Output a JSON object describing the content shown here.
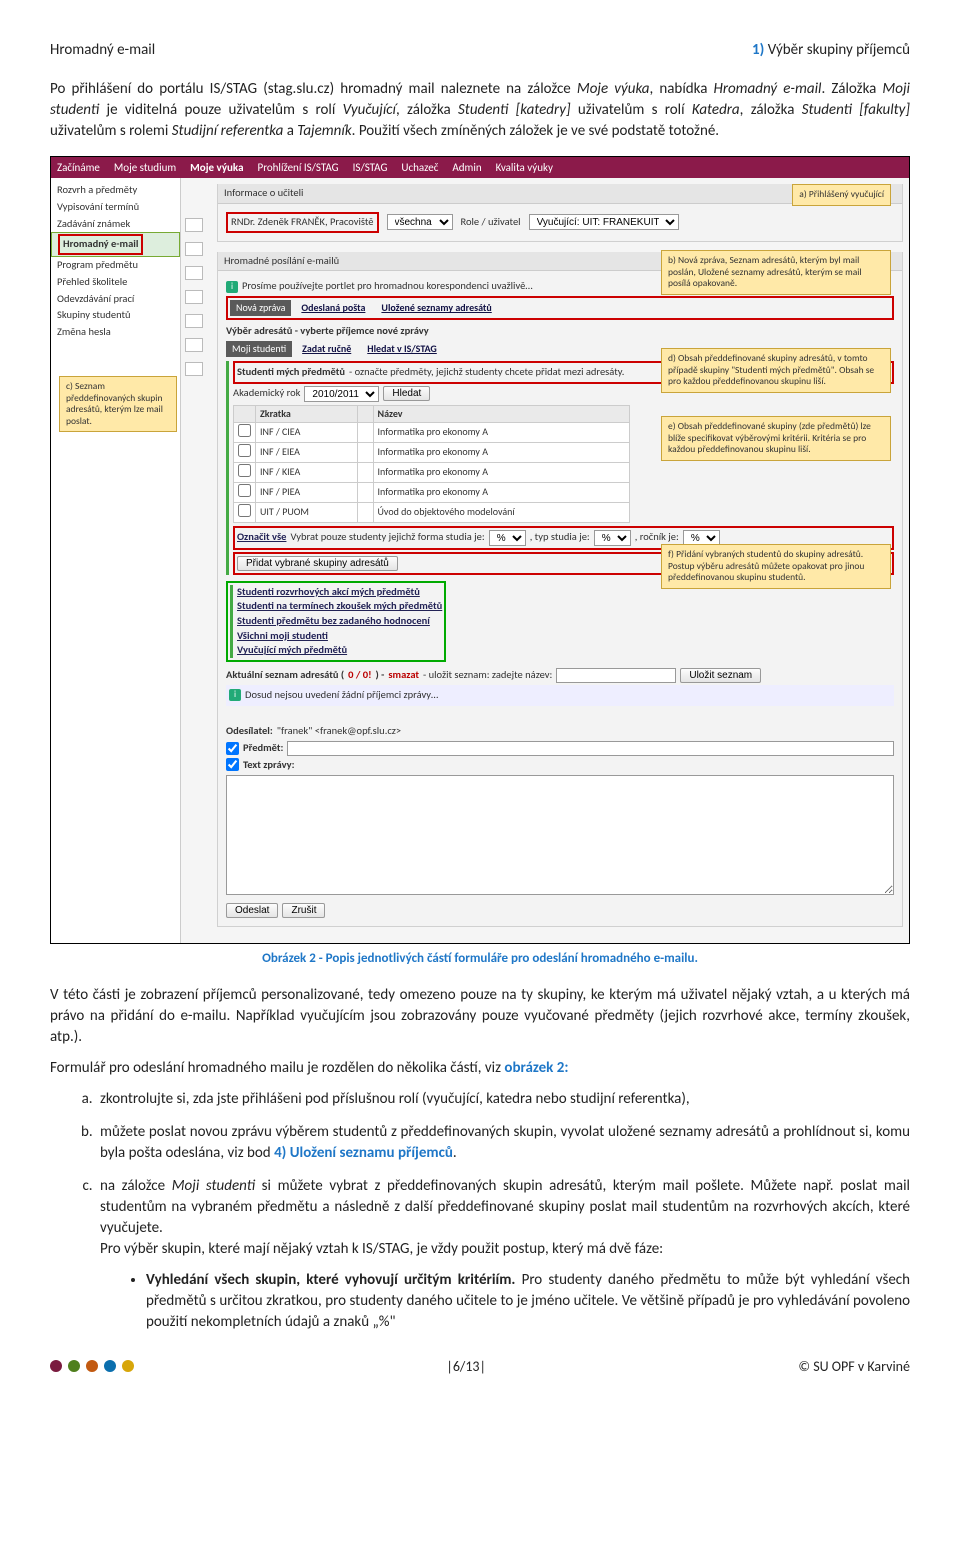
{
  "header": {
    "left": "Hromadný e-mail",
    "right_num": "1)",
    "right_text": " Výběr skupiny příjemců"
  },
  "intro": {
    "p1_a": "Po přihlášení do portálu IS/STAG (stag.slu.cz) hromadný mail naleznete na záložce ",
    "p1_b": "Moje výuka",
    "p1_c": ", nabídka ",
    "p1_d": "Hromadný e-mail",
    "p1_e": ". Záložka ",
    "p1_f": "Moji studenti",
    "p1_g": " je viditelná pouze uživatelům s rolí ",
    "p1_h": "Vyučující",
    "p1_i": ", záložka ",
    "p1_j": "Studenti [katedry]",
    "p1_k": " uživatelům s rolí ",
    "p1_l": "Katedra",
    "p1_m": ", záložka ",
    "p1_n": "Studenti [fakulty]",
    "p1_o": " uživatelům s rolemi ",
    "p1_p": "Studijní referentka",
    "p1_q": " a ",
    "p1_r": "Tajemník",
    "p1_s": ". Použití všech zmíněných záložek je ve své podstatě totožné."
  },
  "shot": {
    "nav": [
      "Začínáme",
      "Moje studium",
      "Moje výuka",
      "Prohlížení IS/STAG",
      "IS/STAG",
      "Uchazeč",
      "Admin",
      "Kvalita výuky"
    ],
    "nav_active": 2,
    "sidebar": [
      "Rozvrh a předměty",
      "Vypisování termínů",
      "Zadávání známek",
      "Hromadný e-mail",
      "Program předmětu",
      "Přehled školitele",
      "Odevzdávání prací",
      "Skupiny studentů",
      "Změna hesla"
    ],
    "sidebar_active": 3,
    "teacher_panel_title": "Informace o učiteli",
    "teacher_name": "RNDr. Zdeněk FRANĚK, Pracoviště",
    "wsel_label": "všechna",
    "role_label": "Role / uživatel",
    "role_value": "Vyučující: UIT: FRANEKUIT",
    "mail_panel_title": "Hromadné posílání e-mailů",
    "mail_warn": "Prosíme používejte portlet pro hromadnou korespondenci uvažlivě…",
    "tab_new": "Nová zpráva",
    "tab_sent": "Odeslaná pošta",
    "tab_saved": "Uložené seznamy adresátů",
    "pick_label": "Výběr adresátů - vyberte příjemce nové zprávy",
    "tab_ms": "Moji studenti",
    "tab_manual": "Zadat ručně",
    "tab_search": "Hledat v IS/STAG",
    "students_head_bold": "Studenti mých předmětů",
    "students_head_rest": " - označte předměty, jejichž studenty chcete přidat mezi adresáty.",
    "ak_year_label": "Akademický rok",
    "ak_year_value": "2010/2011",
    "btn_find": "Hledat",
    "col_zkratka": "Zkratka",
    "col_nazev": "Název",
    "rows": [
      {
        "z": "INF / CIEA",
        "n": "Informatika pro ekonomy A"
      },
      {
        "z": "INF / EIEA",
        "n": "Informatika pro ekonomy A"
      },
      {
        "z": "INF / KIEA",
        "n": "Informatika pro ekonomy A"
      },
      {
        "z": "INF / PIEA",
        "n": "Informatika pro ekonomy A"
      },
      {
        "z": "UIT / PUOM",
        "n": "Úvod do objektového modelování"
      }
    ],
    "select_all": "Označit vše",
    "filter_text1": " Vybrat pouze studenty jejichž forma studia je:",
    "filter_text2": ", typ studia je:",
    "filter_text3": ", ročník je:",
    "pct": "%",
    "btn_add": "Přidat vybrané skupiny adresátů",
    "predef": [
      "Studenti rozvrhových akcí mých předmětů",
      "Studenti na termínech zkoušek mých předmětů",
      "Studenti předmětu bez zadaného hodnocení",
      "Všichni moji studenti",
      "Vyučující mých předmětů"
    ],
    "list_label_a": "Aktuální seznam adresátů (",
    "list_count": "0 / 0!",
    "list_label_b": ") - ",
    "list_smazat": "smazat",
    "list_label_c": " - uložit seznam: zadejte název:",
    "btn_save": "Uložit seznam",
    "empty_msg": "Dosud nejsou uvedení žádní příjemci zprávy…",
    "sender_label": "Odesílatel:",
    "sender_value": "\"franek\" <franek@opf.slu.cz>",
    "subject_label": "Předmět:",
    "body_label": "Text zprávy:",
    "btn_send": "Odeslat",
    "btn_cancel": "Zrušit",
    "notes": {
      "a": "a) Přihlášený vyučující",
      "b": "b) Nová zpráva, Seznam adresátů, kterým byl mail poslán, Uložené seznamy adresátů, kterým se mail posílá opakovaně.",
      "c": "c) Seznam předdefinovaných skupin adresátů, kterým lze mail poslat.",
      "d": "d) Obsah předdefinované skupiny adresátů, v tomto případě skupiny \"Studenti mých předmětů\". Obsah se pro každou předdefinovanou skupinu liší.",
      "e": "e) Obsah předdefinované skupiny (zde předmětů) lze blíže specifikovat výběrovými kritérii. Kritéria se pro každou předdefinovanou skupinu liší.",
      "f": "f) Přidání vybraných studentů do skupiny adresátů. Postup výběru adresátů můžete opakovat pro jinou předdefinovanou skupinu studentů."
    }
  },
  "caption": "Obrázek 2 - Popis jednotlivých částí formuláře pro odeslání hromadného e-mailu.",
  "body_text": {
    "p2": "V této části je zobrazení příjemců personalizované, tedy omezeno pouze na ty skupiny, ke kterým má uživatel nějaký vztah, a u kterých má právo na přidání do e-mailu. Například vyučujícím jsou zobrazovány pouze vyučované předměty (jejich rozvrhové akce, termíny zkoušek, atp.).",
    "p3_a": "Formulář pro odeslání hromadného mailu je rozdělen do několika částí, viz ",
    "p3_b": "obrázek 2:",
    "li_a": "zkontrolujte si, zda jste přihlášeni pod příslušnou rolí (vyučující, katedra nebo studijní referentka),",
    "li_b_a": "můžete poslat novou zprávu výběrem studentů z předdefinovaných skupin, vyvolat uložené seznamy adresátů a prohlídnout si, komu byla pošta odeslána, viz bod ",
    "li_b_b": "4) Uložení seznamu příjemců",
    "li_b_c": ".",
    "li_c_a": "na záložce ",
    "li_c_b": "Moji studenti",
    "li_c_c": " si můžete vybrat z předdefinovaných skupin adresátů, kterým mail pošlete. Můžete např. poslat mail studentům na vybraném předmětu a následně z další předdefinované skupiny poslat mail studentům na rozvrhových akcích, které vyučujete.",
    "li_c_d": "Pro výběr skupin, které mají nějaký vztah k IS/STAG, je vždy použit postup, který má dvě fáze:",
    "bullet_a": "Vyhledání všech skupin, které vyhovují určitým kritériím.",
    "bullet_b": " Pro studenty daného předmětu to může být vyhledání všech předmětů s určitou zkratkou, pro studenty daného učitele to je jméno učitele. Ve většině případů je pro vyhledávání povoleno použití nekompletních údajů a znaků „%\""
  },
  "footer": {
    "page": "|6/13|",
    "copy": "© SU OPF v Karviné"
  }
}
